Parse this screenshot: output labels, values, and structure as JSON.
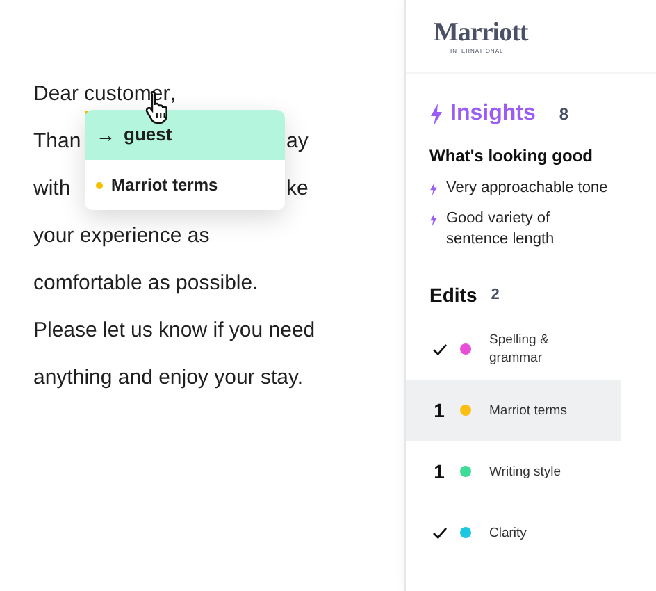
{
  "editor": {
    "lines": [
      {
        "segments": [
          {
            "kind": "text",
            "text": "Dear",
            "flagged": false
          },
          {
            "kind": "text",
            "text": "customer",
            "flagged": true
          },
          {
            "kind": "text",
            "text": ",",
            "flagged": false
          }
        ]
      },
      {
        "segments": [
          {
            "kind": "text",
            "text": "Than",
            "flagged": false
          },
          {
            "kind": "after_popup",
            "text": "ay",
            "flagged": false
          }
        ]
      },
      {
        "segments": [
          {
            "kind": "text",
            "text": "with",
            "flagged": false
          },
          {
            "kind": "after_popup",
            "text": "ke",
            "flagged": false
          }
        ]
      },
      {
        "segments": [
          {
            "kind": "text",
            "text": "your experience as",
            "flagged": false
          }
        ]
      },
      {
        "segments": [
          {
            "kind": "text",
            "text": "comfortable as possible.",
            "flagged": false
          }
        ]
      },
      {
        "segments": [
          {
            "kind": "text",
            "text": "Please let us know if you need",
            "flagged": false
          }
        ]
      },
      {
        "segments": [
          {
            "kind": "text",
            "text": "anything and enjoy your stay.",
            "flagged": false
          }
        ]
      }
    ]
  },
  "suggestion_popup": {
    "arrow": "→",
    "replacement": "guest",
    "category": {
      "label": "Marriot terms",
      "color": "#f5c000"
    }
  },
  "sidebar": {
    "logo": {
      "name": "Marriott",
      "tagline": "INTERNATIONAL"
    },
    "insights": {
      "title": "Insights",
      "count": "8",
      "heading": "What's looking good",
      "items": [
        "Very approachable tone",
        "Good variety of sentence length"
      ]
    },
    "edits": {
      "title": "Edits",
      "count": "2",
      "items": [
        {
          "kind": "check",
          "label": "Spelling & grammar",
          "color": "#e94fd6",
          "selected": false
        },
        {
          "kind": "count",
          "count": "1",
          "label": "Marriot terms",
          "color": "#fbbf14",
          "selected": true
        },
        {
          "kind": "count",
          "count": "1",
          "label": "Writing style",
          "color": "#3ddc97",
          "selected": false
        },
        {
          "kind": "check",
          "label": "Clarity",
          "color": "#1cc8e0",
          "selected": false
        }
      ]
    }
  }
}
